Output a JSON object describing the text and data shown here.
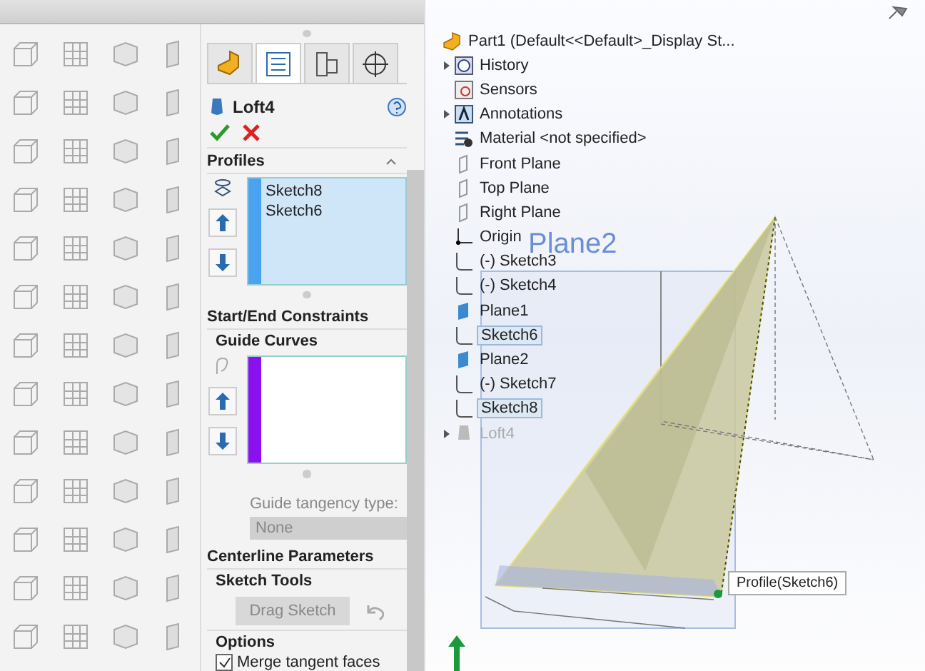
{
  "property_manager": {
    "tabs": [
      {
        "kind": "part",
        "selected": false
      },
      {
        "kind": "list",
        "selected": true
      },
      {
        "kind": "config",
        "selected": false
      },
      {
        "kind": "target",
        "selected": false
      }
    ],
    "title": "Loft4",
    "sections": [
      {
        "kind": "list",
        "header": "Profiles",
        "collapse": true,
        "color": "#4aa3f0",
        "active": true,
        "items": [
          "Sketch8",
          "Sketch6"
        ]
      },
      {
        "kind": "header",
        "header": "Start/End Constraints"
      },
      {
        "kind": "list",
        "header": "Guide Curves",
        "color": "#8b10f0",
        "active": false,
        "tangency_label": "Guide tangency type:",
        "tangency_value": "None"
      },
      {
        "kind": "header",
        "header": "Centerline Parameters"
      },
      {
        "kind": "tools",
        "header": "Sketch Tools",
        "button": "Drag Sketch"
      },
      {
        "kind": "options",
        "header": "Options",
        "checkbox": {
          "label": "Merge tangent faces",
          "checked": true
        }
      }
    ]
  },
  "tree": {
    "label": "Part1  (Default<<Default>_Display St...",
    "kind": "part",
    "children": [
      {
        "label": "History",
        "kind": "history",
        "expandable": true,
        "selected": false,
        "dimmed": false
      },
      {
        "label": "Sensors",
        "kind": "sensor",
        "expandable": false,
        "selected": false,
        "dimmed": false
      },
      {
        "label": "Annotations",
        "kind": "annotation",
        "expandable": true,
        "selected": false,
        "dimmed": false
      },
      {
        "label": "Material <not specified>",
        "kind": "material",
        "expandable": false,
        "selected": false,
        "dimmed": false
      },
      {
        "label": "Front Plane",
        "kind": "plane",
        "expandable": false,
        "selected": false,
        "dimmed": false
      },
      {
        "label": "Top Plane",
        "kind": "plane",
        "expandable": false,
        "selected": false,
        "dimmed": false
      },
      {
        "label": "Right Plane",
        "kind": "plane",
        "expandable": false,
        "selected": false,
        "dimmed": false
      },
      {
        "label": "Origin",
        "kind": "origin",
        "expandable": false,
        "selected": false,
        "dimmed": false
      },
      {
        "label": "(-) Sketch3",
        "kind": "sketch",
        "expandable": false,
        "selected": false,
        "dimmed": false
      },
      {
        "label": "(-) Sketch4",
        "kind": "sketch",
        "expandable": false,
        "selected": false,
        "dimmed": false
      },
      {
        "label": "Plane1",
        "kind": "refplane",
        "expandable": false,
        "selected": false,
        "dimmed": false
      },
      {
        "label": "Sketch6",
        "kind": "sketch",
        "expandable": false,
        "selected": true,
        "dimmed": false
      },
      {
        "label": "Plane2",
        "kind": "refplane",
        "expandable": false,
        "selected": false,
        "dimmed": false
      },
      {
        "label": "(-) Sketch7",
        "kind": "sketch",
        "expandable": false,
        "selected": false,
        "dimmed": false
      },
      {
        "label": "Sketch8",
        "kind": "sketch",
        "expandable": false,
        "selected": true,
        "dimmed": false
      },
      {
        "label": "Loft4",
        "kind": "loft",
        "expandable": true,
        "selected": false,
        "dimmed": true
      }
    ]
  },
  "viewport": {
    "plane_label": "Plane2",
    "tooltip": "Profile(Sketch6)"
  }
}
